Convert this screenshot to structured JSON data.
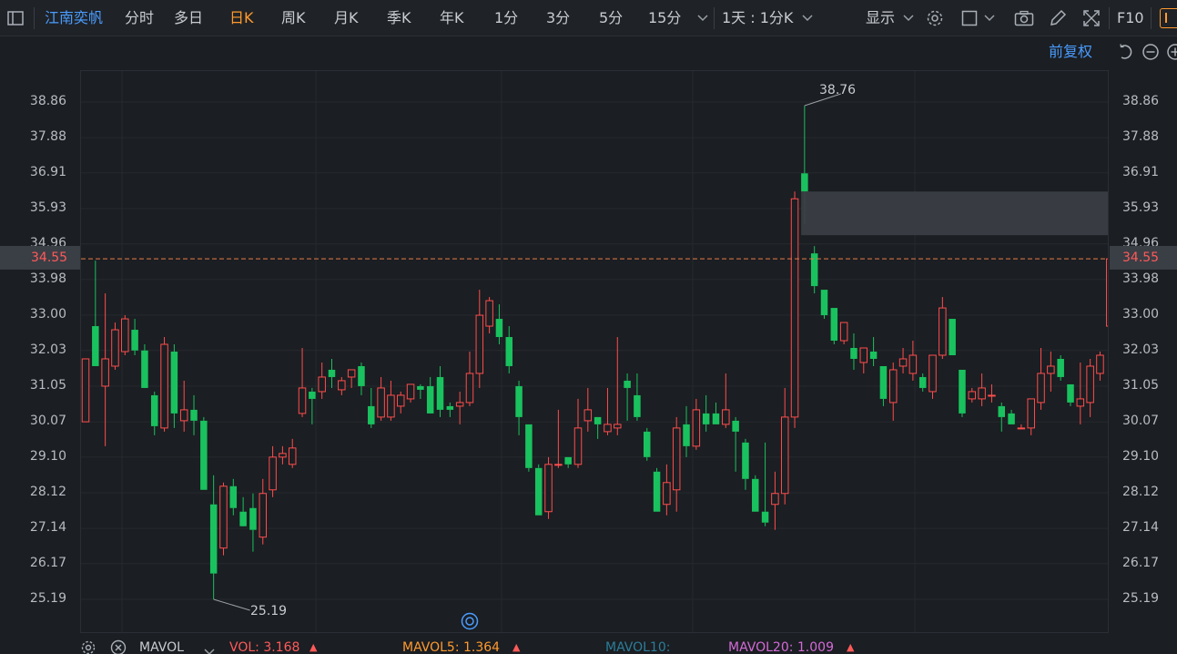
{
  "toolbar": {
    "stock_name": "江南奕帆",
    "periods": [
      "分时",
      "多日",
      "日K",
      "周K",
      "月K",
      "季K",
      "年K",
      "1分",
      "3分",
      "5分",
      "15分"
    ],
    "active_period": "日K",
    "interval_select": "1天 : 1分K",
    "display_label": "显示",
    "f10_label": "F10"
  },
  "chart_header": {
    "adjust_label": "前复权"
  },
  "axis": {
    "ticks": [
      "38.86",
      "37.88",
      "36.91",
      "35.93",
      "34.96",
      "33.98",
      "33.00",
      "32.03",
      "31.05",
      "30.07",
      "29.10",
      "28.12",
      "27.14",
      "26.17",
      "25.19"
    ],
    "current_price": "34.55"
  },
  "annotations": {
    "high": "38.76",
    "low": "25.19"
  },
  "indicators": {
    "name": "MAVOL",
    "vol": "VOL: 3.168",
    "mavol5": "MAVOL5: 1.364",
    "mavol10": "MAVOL10:",
    "mavol20": "MAVOL20: 1.009"
  },
  "colors": {
    "up": "#ff4d4d",
    "down": "#19c25e",
    "accent": "#ff9a2e",
    "link": "#4a9cff"
  },
  "chart_data": {
    "type": "candlestick",
    "ylim": [
      24.5,
      39.6
    ],
    "candles": [
      {
        "o": 30.07,
        "h": 31.8,
        "l": 30.07,
        "c": 31.8
      },
      {
        "o": 32.7,
        "h": 34.5,
        "l": 31.6,
        "c": 31.6
      },
      {
        "o": 31.05,
        "h": 33.6,
        "l": 29.4,
        "c": 31.8
      },
      {
        "o": 31.6,
        "h": 32.8,
        "l": 31.5,
        "c": 32.6
      },
      {
        "o": 32.0,
        "h": 33.0,
        "l": 31.9,
        "c": 32.9
      },
      {
        "o": 32.6,
        "h": 32.9,
        "l": 31.9,
        "c": 32.03
      },
      {
        "o": 32.03,
        "h": 32.2,
        "l": 31.1,
        "c": 31.0
      },
      {
        "o": 30.8,
        "h": 30.9,
        "l": 29.7,
        "c": 29.95
      },
      {
        "o": 29.9,
        "h": 32.4,
        "l": 29.8,
        "c": 32.2
      },
      {
        "o": 32.0,
        "h": 32.2,
        "l": 29.9,
        "c": 30.3
      },
      {
        "o": 30.1,
        "h": 31.2,
        "l": 29.8,
        "c": 30.4
      },
      {
        "o": 30.4,
        "h": 30.8,
        "l": 29.7,
        "c": 30.1
      },
      {
        "o": 30.1,
        "h": 30.2,
        "l": 28.2,
        "c": 28.2
      },
      {
        "o": 27.8,
        "h": 28.6,
        "l": 25.19,
        "c": 25.9
      },
      {
        "o": 26.6,
        "h": 28.4,
        "l": 26.4,
        "c": 28.3
      },
      {
        "o": 28.3,
        "h": 28.5,
        "l": 27.5,
        "c": 27.7
      },
      {
        "o": 27.6,
        "h": 28.0,
        "l": 27.3,
        "c": 27.2
      },
      {
        "o": 27.7,
        "h": 28.1,
        "l": 26.5,
        "c": 27.1
      },
      {
        "o": 26.9,
        "h": 28.5,
        "l": 26.7,
        "c": 28.1
      },
      {
        "o": 28.2,
        "h": 29.4,
        "l": 28.0,
        "c": 29.1
      },
      {
        "o": 29.1,
        "h": 29.4,
        "l": 28.9,
        "c": 29.2
      },
      {
        "o": 28.9,
        "h": 29.6,
        "l": 28.8,
        "c": 29.35
      },
      {
        "o": 30.3,
        "h": 32.1,
        "l": 30.2,
        "c": 31.0
      },
      {
        "o": 30.9,
        "h": 31.0,
        "l": 30.0,
        "c": 30.7
      },
      {
        "o": 30.9,
        "h": 31.7,
        "l": 30.7,
        "c": 31.3
      },
      {
        "o": 31.5,
        "h": 31.8,
        "l": 31.0,
        "c": 31.3
      },
      {
        "o": 30.95,
        "h": 31.3,
        "l": 30.8,
        "c": 31.2
      },
      {
        "o": 31.3,
        "h": 31.5,
        "l": 31.0,
        "c": 31.5
      },
      {
        "o": 31.6,
        "h": 31.7,
        "l": 30.8,
        "c": 31.05
      },
      {
        "o": 30.5,
        "h": 31.0,
        "l": 29.9,
        "c": 30.0
      },
      {
        "o": 30.2,
        "h": 31.3,
        "l": 30.1,
        "c": 31.0
      },
      {
        "o": 30.2,
        "h": 31.2,
        "l": 30.1,
        "c": 30.8
      },
      {
        "o": 30.5,
        "h": 30.9,
        "l": 30.3,
        "c": 30.8
      },
      {
        "o": 30.7,
        "h": 31.1,
        "l": 30.6,
        "c": 31.1
      },
      {
        "o": 31.05,
        "h": 31.1,
        "l": 30.7,
        "c": 30.95
      },
      {
        "o": 31.05,
        "h": 31.3,
        "l": 30.3,
        "c": 30.3
      },
      {
        "o": 31.3,
        "h": 31.6,
        "l": 30.2,
        "c": 30.4
      },
      {
        "o": 30.5,
        "h": 30.6,
        "l": 30.2,
        "c": 30.4
      },
      {
        "o": 30.5,
        "h": 30.9,
        "l": 30.0,
        "c": 30.6
      },
      {
        "o": 30.6,
        "h": 32.0,
        "l": 30.5,
        "c": 31.4
      },
      {
        "o": 31.4,
        "h": 33.7,
        "l": 31.0,
        "c": 33.0
      },
      {
        "o": 32.7,
        "h": 33.5,
        "l": 32.5,
        "c": 33.4
      },
      {
        "o": 32.9,
        "h": 33.3,
        "l": 32.2,
        "c": 32.4
      },
      {
        "o": 32.4,
        "h": 32.7,
        "l": 31.4,
        "c": 31.6
      },
      {
        "o": 31.05,
        "h": 31.2,
        "l": 29.7,
        "c": 30.2
      },
      {
        "o": 30.0,
        "h": 30.0,
        "l": 28.7,
        "c": 28.8
      },
      {
        "o": 28.8,
        "h": 28.9,
        "l": 27.5,
        "c": 27.5
      },
      {
        "o": 27.6,
        "h": 29.1,
        "l": 27.4,
        "c": 28.9
      },
      {
        "o": 28.9,
        "h": 30.4,
        "l": 28.8,
        "c": 28.9
      },
      {
        "o": 29.1,
        "h": 29.1,
        "l": 28.8,
        "c": 28.9
      },
      {
        "o": 28.9,
        "h": 30.7,
        "l": 28.8,
        "c": 29.9
      },
      {
        "o": 30.1,
        "h": 31.0,
        "l": 29.8,
        "c": 30.4
      },
      {
        "o": 30.2,
        "h": 30.2,
        "l": 29.6,
        "c": 30.0
      },
      {
        "o": 29.8,
        "h": 31.0,
        "l": 29.7,
        "c": 30.0
      },
      {
        "o": 29.9,
        "h": 32.4,
        "l": 29.7,
        "c": 30.0
      },
      {
        "o": 31.2,
        "h": 31.4,
        "l": 30.1,
        "c": 31.0
      },
      {
        "o": 30.8,
        "h": 31.4,
        "l": 30.1,
        "c": 30.2
      },
      {
        "o": 29.8,
        "h": 29.9,
        "l": 29.0,
        "c": 29.1
      },
      {
        "o": 28.7,
        "h": 28.8,
        "l": 27.6,
        "c": 27.6
      },
      {
        "o": 27.8,
        "h": 28.9,
        "l": 27.5,
        "c": 28.4
      },
      {
        "o": 28.2,
        "h": 30.2,
        "l": 27.6,
        "c": 29.9
      },
      {
        "o": 30.0,
        "h": 30.5,
        "l": 29.1,
        "c": 29.4
      },
      {
        "o": 29.4,
        "h": 30.7,
        "l": 29.3,
        "c": 30.4
      },
      {
        "o": 30.3,
        "h": 30.8,
        "l": 29.8,
        "c": 30.0
      },
      {
        "o": 30.3,
        "h": 30.6,
        "l": 30.0,
        "c": 30.0
      },
      {
        "o": 30.0,
        "h": 31.4,
        "l": 29.9,
        "c": 30.4
      },
      {
        "o": 30.1,
        "h": 30.2,
        "l": 28.7,
        "c": 29.8
      },
      {
        "o": 29.5,
        "h": 29.6,
        "l": 28.2,
        "c": 28.5
      },
      {
        "o": 28.5,
        "h": 28.6,
        "l": 27.6,
        "c": 27.6
      },
      {
        "o": 27.6,
        "h": 29.5,
        "l": 27.2,
        "c": 27.3
      },
      {
        "o": 27.8,
        "h": 28.7,
        "l": 27.1,
        "c": 28.1
      },
      {
        "o": 28.1,
        "h": 31.0,
        "l": 27.8,
        "c": 30.2
      },
      {
        "o": 30.2,
        "h": 36.4,
        "l": 29.9,
        "c": 36.2
      },
      {
        "o": 36.9,
        "h": 38.76,
        "l": 35.5,
        "c": 36.4
      },
      {
        "o": 34.7,
        "h": 34.9,
        "l": 33.6,
        "c": 33.8
      },
      {
        "o": 33.7,
        "h": 33.7,
        "l": 32.9,
        "c": 33.0
      },
      {
        "o": 33.2,
        "h": 33.2,
        "l": 32.2,
        "c": 32.3
      },
      {
        "o": 32.3,
        "h": 32.8,
        "l": 32.2,
        "c": 32.8
      },
      {
        "o": 32.1,
        "h": 32.5,
        "l": 31.5,
        "c": 31.8
      },
      {
        "o": 31.7,
        "h": 32.1,
        "l": 31.4,
        "c": 32.1
      },
      {
        "o": 32.0,
        "h": 32.4,
        "l": 31.6,
        "c": 31.8
      },
      {
        "o": 31.6,
        "h": 31.6,
        "l": 30.5,
        "c": 30.7
      },
      {
        "o": 30.6,
        "h": 31.7,
        "l": 30.1,
        "c": 31.5
      },
      {
        "o": 31.6,
        "h": 32.1,
        "l": 31.4,
        "c": 31.8
      },
      {
        "o": 31.4,
        "h": 32.3,
        "l": 31.2,
        "c": 31.9
      },
      {
        "o": 31.3,
        "h": 31.4,
        "l": 30.9,
        "c": 31.0
      },
      {
        "o": 30.9,
        "h": 31.9,
        "l": 30.7,
        "c": 31.9
      },
      {
        "o": 31.9,
        "h": 33.5,
        "l": 31.8,
        "c": 33.2
      },
      {
        "o": 32.9,
        "h": 32.9,
        "l": 31.9,
        "c": 31.9
      },
      {
        "o": 31.5,
        "h": 31.5,
        "l": 30.2,
        "c": 30.3
      },
      {
        "o": 30.7,
        "h": 31.0,
        "l": 30.6,
        "c": 30.9
      },
      {
        "o": 30.7,
        "h": 31.4,
        "l": 30.5,
        "c": 31.0
      },
      {
        "o": 30.8,
        "h": 31.1,
        "l": 30.6,
        "c": 30.8
      },
      {
        "o": 30.5,
        "h": 30.6,
        "l": 29.8,
        "c": 30.2
      },
      {
        "o": 30.3,
        "h": 30.4,
        "l": 30.0,
        "c": 30.0
      },
      {
        "o": 29.9,
        "h": 30.0,
        "l": 29.9,
        "c": 29.9
      },
      {
        "o": 29.9,
        "h": 30.7,
        "l": 29.7,
        "c": 30.7
      },
      {
        "o": 30.6,
        "h": 32.1,
        "l": 30.4,
        "c": 31.4
      },
      {
        "o": 31.4,
        "h": 32.0,
        "l": 30.9,
        "c": 31.6
      },
      {
        "o": 31.8,
        "h": 31.9,
        "l": 31.2,
        "c": 31.3
      },
      {
        "o": 31.1,
        "h": 31.1,
        "l": 30.5,
        "c": 30.6
      },
      {
        "o": 30.5,
        "h": 31.7,
        "l": 30.0,
        "c": 30.7
      },
      {
        "o": 30.6,
        "h": 31.8,
        "l": 30.2,
        "c": 31.6
      },
      {
        "o": 31.4,
        "h": 32.0,
        "l": 31.2,
        "c": 31.9
      },
      {
        "o": 32.7,
        "h": 35.1,
        "l": 32.7,
        "c": 34.55
      }
    ],
    "gap_box": {
      "x_from": 73,
      "x_to": 105,
      "y_from": 35.2,
      "y_to": 36.4
    },
    "price_line": 34.55
  }
}
